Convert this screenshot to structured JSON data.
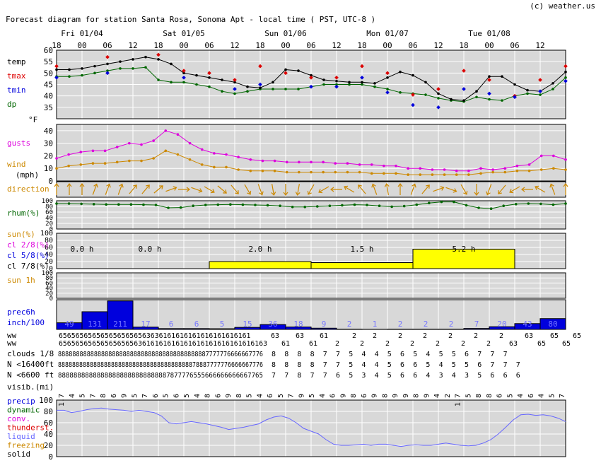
{
  "header": {
    "title": "Forecast diagram for station Santa Rosa, Sonoma Apt  - local time ( PST, UTC-8 )",
    "credit": "(c) weather.us"
  },
  "colors": {
    "temp": "#000000",
    "tmax": "#dd0000",
    "tmin": "#0000dd",
    "dp": "#006600",
    "gusts": "#dd00dd",
    "wind": "#cc8800",
    "direction": "#cc8800",
    "rhum": "#006600",
    "sun": "#ffff00",
    "precip": "#0000dd",
    "panel": "#d8d8d8",
    "grid": "#ffffff",
    "liquid": "#6666ff"
  },
  "chart_data": {
    "type": "line",
    "day_labels": [
      {
        "label": "Fri 01/04",
        "hour_index": 6
      },
      {
        "label": "Sat 01/05",
        "hour_index": 30
      },
      {
        "label": "Sun 01/06",
        "hour_index": 54
      },
      {
        "label": "Mon 01/07",
        "hour_index": 78
      },
      {
        "label": "Tue 01/08",
        "hour_index": 102
      }
    ],
    "hour_ticks": [
      "18",
      "00",
      "06",
      "12",
      "18",
      "00",
      "06",
      "12",
      "18",
      "00",
      "06",
      "12",
      "18",
      "00",
      "06",
      "12",
      "18",
      "00",
      "06",
      "12"
    ],
    "hours_from_start": [
      0,
      3,
      6,
      9,
      12,
      15,
      18,
      21,
      24,
      27,
      30,
      33,
      36,
      39,
      42,
      45,
      48,
      51,
      54,
      57,
      60,
      63,
      66,
      69,
      72,
      75,
      78,
      81,
      84,
      87,
      90,
      93,
      96,
      99,
      102,
      105,
      108,
      111,
      114,
      117,
      120
    ],
    "temperature": {
      "labels": [
        "temp",
        "tmax",
        "tmin",
        "dp"
      ],
      "unit": "°F",
      "ylim": [
        30,
        60
      ],
      "yticks": [
        35,
        40,
        45,
        50,
        55,
        60
      ],
      "temp": [
        51.5,
        51.5,
        52,
        53,
        54,
        55,
        56,
        57,
        56,
        54,
        50,
        49,
        48,
        47,
        46,
        44,
        43.5,
        46,
        51.5,
        51,
        49,
        47,
        46.5,
        46,
        46,
        45.5,
        48,
        50.5,
        49,
        46,
        41,
        38.5,
        38,
        42,
        48.5,
        48.5,
        45,
        42.5,
        42,
        45.5,
        50.5
      ],
      "dp": [
        48.5,
        48.5,
        49,
        50,
        51,
        52,
        52,
        52.5,
        47,
        46,
        46,
        45,
        44,
        42,
        41,
        42,
        43,
        43,
        43,
        43,
        44,
        45,
        45,
        45,
        45,
        44,
        43,
        41.5,
        41,
        40.5,
        39,
        38,
        37.5,
        39.5,
        38.5,
        38,
        40,
        41,
        40.5,
        43,
        48
      ],
      "tmax": [
        {
          "h": 0,
          "v": 53
        },
        {
          "h": 12,
          "v": 57
        },
        {
          "h": 24,
          "v": 58
        },
        {
          "h": 30,
          "v": 51
        },
        {
          "h": 36,
          "v": 50
        },
        {
          "h": 42,
          "v": 47
        },
        {
          "h": 48,
          "v": 53
        },
        {
          "h": 54,
          "v": 50
        },
        {
          "h": 60,
          "v": 48
        },
        {
          "h": 66,
          "v": 48
        },
        {
          "h": 72,
          "v": 53
        },
        {
          "h": 78,
          "v": 50
        },
        {
          "h": 84,
          "v": 40.5
        },
        {
          "h": 90,
          "v": 43
        },
        {
          "h": 96,
          "v": 51
        },
        {
          "h": 102,
          "v": 47
        },
        {
          "h": 108,
          "v": 40
        },
        {
          "h": 114,
          "v": 47
        },
        {
          "h": 120,
          "v": 53
        }
      ],
      "tmin": [
        {
          "h": 0,
          "v": 48
        },
        {
          "h": 12,
          "v": 50
        },
        {
          "h": 30,
          "v": 48
        },
        {
          "h": 42,
          "v": 43
        },
        {
          "h": 48,
          "v": 45
        },
        {
          "h": 60,
          "v": 44
        },
        {
          "h": 66,
          "v": 44
        },
        {
          "h": 72,
          "v": 48
        },
        {
          "h": 78,
          "v": 41.5
        },
        {
          "h": 84,
          "v": 36
        },
        {
          "h": 90,
          "v": 35
        },
        {
          "h": 96,
          "v": 43
        },
        {
          "h": 102,
          "v": 41
        },
        {
          "h": 108,
          "v": 39.5
        },
        {
          "h": 114,
          "v": 42
        },
        {
          "h": 120,
          "v": 46.5
        }
      ]
    },
    "wind": {
      "labels": [
        "gusts",
        "wind",
        "(mph)",
        "direction"
      ],
      "ylim": [
        0,
        45
      ],
      "yticks": [
        0,
        10,
        20,
        30,
        40
      ],
      "gusts": [
        18,
        21,
        23,
        24,
        24,
        27,
        30,
        29,
        32,
        40,
        37,
        30,
        25,
        22,
        21,
        19,
        17,
        16,
        16,
        15,
        15,
        15,
        15,
        14,
        14,
        13,
        13,
        12,
        12,
        10,
        10,
        9,
        9,
        8,
        8,
        10,
        9,
        10,
        12,
        13,
        20,
        20,
        17
      ],
      "wind": [
        10,
        12,
        13,
        14,
        14,
        15,
        16,
        16,
        18,
        24,
        21,
        17,
        13,
        11,
        11,
        9,
        8,
        8,
        8,
        7,
        7,
        7,
        7,
        7,
        7,
        7,
        6,
        6,
        6,
        5,
        5,
        5,
        5,
        5,
        5,
        6,
        7,
        7,
        8,
        8,
        9,
        10,
        9
      ],
      "direction_deg": [
        180,
        180,
        180,
        200,
        200,
        200,
        220,
        220,
        230,
        250,
        270,
        290,
        300,
        310,
        320,
        330,
        340,
        350,
        0,
        10,
        30,
        60,
        90,
        120,
        140,
        160,
        170,
        180,
        200,
        220,
        250,
        290,
        330,
        0,
        20,
        40,
        60,
        90,
        120,
        160,
        180
      ]
    },
    "rhum": {
      "label": "rhum(%)",
      "yticks": [
        0,
        20,
        40,
        60,
        80,
        100
      ],
      "values": [
        90,
        90,
        89,
        88,
        87,
        87,
        87,
        86,
        85,
        75,
        76,
        82,
        85,
        86,
        87,
        86,
        85,
        84,
        82,
        78,
        78,
        80,
        82,
        84,
        86,
        85,
        82,
        79,
        81,
        86,
        92,
        96,
        96,
        84,
        75,
        72,
        82,
        88,
        90,
        89,
        86,
        90
      ]
    },
    "sun": {
      "labels": [
        "sun(%)",
        "cl 2/8(%)",
        "cl 5/8(%)",
        "cl 7/8(%)"
      ],
      "yticks": [
        0,
        20,
        40,
        60,
        80,
        100
      ],
      "bars": [
        {
          "start": 36,
          "end": 60,
          "value": 20
        },
        {
          "start": 60,
          "end": 84,
          "value": 17
        },
        {
          "start": 84,
          "end": 108,
          "value": 55
        }
      ],
      "daily_hours": [
        {
          "label": "0.0 h",
          "center": 6
        },
        {
          "label": "0.0 h",
          "center": 22
        },
        {
          "label": "2.0 h",
          "center": 48
        },
        {
          "label": "1.5 h",
          "center": 72
        },
        {
          "label": "5.2 h",
          "center": 96
        }
      ]
    },
    "sun1h": {
      "label": "sun 1h",
      "yticks": [
        0,
        20,
        40,
        60,
        80,
        100
      ]
    },
    "precip": {
      "labels": [
        "prec6h",
        "inch/100"
      ],
      "ylim": [
        0,
        220
      ],
      "values": [
        49,
        131,
        211,
        17,
        6,
        6,
        5,
        15,
        36,
        18,
        9,
        2,
        1,
        2,
        2,
        2,
        7,
        20,
        43,
        80
      ],
      "value_labels": [
        "49",
        "131",
        "211",
        "17",
        "6",
        "6",
        "5",
        "15",
        "36",
        "18",
        "9",
        "2",
        "1",
        "2",
        "2",
        "2",
        "7",
        "20",
        "43",
        "80"
      ]
    },
    "ww_label": "ww",
    "ww_row1": [
      "6565656565656565656563636161616161616161616161",
      "63",
      "63",
      "61",
      "2",
      "2",
      "2",
      "2",
      "2",
      "2",
      "2",
      "63",
      "65",
      "65"
    ],
    "ww_row2": [
      "65656565656565656563616161616161616161616161616163",
      "61",
      "61",
      "2",
      "2",
      "2",
      "2",
      "2",
      "2",
      "2",
      "63",
      "65",
      "65"
    ],
    "clouds": {
      "rows": [
        {
          "label": "clouds 1/8",
          "dense": "888888888888888888888888888888888888888887777776666667776",
          "tail": [
            "8",
            "8",
            "8",
            "8",
            "7",
            "7",
            "5",
            "4",
            "4",
            "5",
            "6",
            "5",
            "4",
            "5",
            "5",
            "6",
            "7",
            "7",
            "7"
          ]
        },
        {
          "label": "N <16400ft",
          "dense": "8888888888888888888888888888888888888878887777776666667776",
          "tail": [
            "8",
            "8",
            "8",
            "8",
            "7",
            "7",
            "5",
            "4",
            "4",
            "5",
            "6",
            "6",
            "5",
            "4",
            "5",
            "5",
            "6",
            "7",
            "7",
            "7"
          ]
        },
        {
          "label": "N <6600 ft",
          "dense": "88888888888888888888888888887877776555666666666667765",
          "tail": [
            "7",
            "7",
            "8",
            "7",
            "7",
            "6",
            "5",
            "3",
            "4",
            "5",
            "6",
            "6",
            "4",
            "3",
            "4",
            "3",
            "5",
            "6",
            "6",
            "6"
          ]
        }
      ]
    },
    "visibility": {
      "label": "visib.(mi)",
      "values": [
        "1.7",
        "4",
        "5",
        "7",
        "8",
        "6",
        "9",
        "5",
        "7",
        "6",
        "5",
        "6",
        "5",
        "4",
        "8",
        "6",
        "9",
        "8",
        "5",
        "4",
        "6",
        "5",
        "7",
        "9",
        "5",
        "4",
        "6",
        "9",
        "8",
        "6",
        "9",
        "8",
        "9",
        "9",
        "8",
        "9",
        "4",
        "2",
        "1.7",
        "5",
        "8",
        "8",
        "6",
        "5",
        "4",
        "6",
        "4",
        "5",
        "7"
      ]
    },
    "clouds_lower": {
      "labels": [
        "precip",
        "dynamic",
        "conv.",
        "thunderst.",
        "liquid",
        "freezing",
        "solid"
      ],
      "label_colors": [
        "#0000dd",
        "#006600",
        "#dd00dd",
        "#dd0000",
        "#6666ff",
        "#cc8800",
        "#000000"
      ],
      "yticks": [
        0,
        20,
        40,
        60,
        80,
        100
      ],
      "liquid": [
        82,
        82,
        78,
        80,
        83,
        85,
        86,
        84,
        83,
        82,
        80,
        82,
        80,
        78,
        72,
        60,
        58,
        60,
        62,
        60,
        58,
        55,
        52,
        48,
        50,
        52,
        55,
        58,
        65,
        70,
        72,
        68,
        60,
        50,
        45,
        40,
        30,
        22,
        20,
        20,
        21,
        22,
        20,
        22,
        22,
        20,
        18,
        20,
        21,
        20,
        20,
        22,
        24,
        22,
        20,
        19,
        20,
        24,
        30,
        40,
        52,
        65,
        74,
        75,
        73,
        74,
        72,
        68,
        62
      ]
    }
  }
}
